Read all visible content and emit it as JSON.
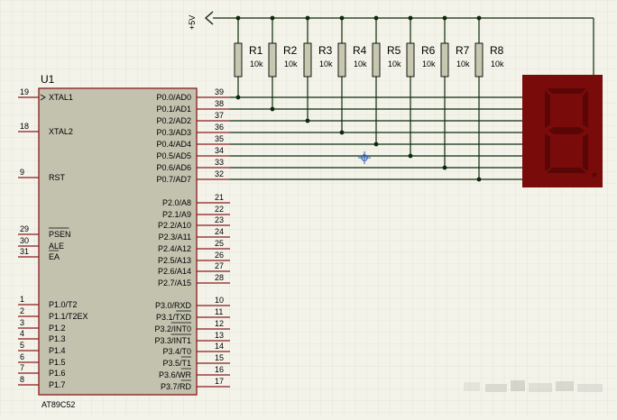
{
  "schematic": {
    "power_label": "+5V",
    "chip": {
      "ref": "U1",
      "part": "AT89C52",
      "left_pins": [
        {
          "num": "19",
          "label": "XTAL1"
        },
        {
          "num": "18",
          "label": "XTAL2"
        },
        {
          "num": "9",
          "label": "RST"
        },
        {
          "num": "29",
          "label": "PSEN"
        },
        {
          "num": "30",
          "label": "ALE"
        },
        {
          "num": "31",
          "label": "EA"
        },
        {
          "num": "1",
          "label": "P1.0/T2"
        },
        {
          "num": "2",
          "label": "P1.1/T2EX"
        },
        {
          "num": "3",
          "label": "P1.2"
        },
        {
          "num": "4",
          "label": "P1.3"
        },
        {
          "num": "5",
          "label": "P1.4"
        },
        {
          "num": "6",
          "label": "P1.5"
        },
        {
          "num": "7",
          "label": "P1.6"
        },
        {
          "num": "8",
          "label": "P1.7"
        }
      ],
      "right_pins": [
        {
          "num": "39",
          "label": "P0.0/AD0"
        },
        {
          "num": "38",
          "label": "P0.1/AD1"
        },
        {
          "num": "37",
          "label": "P0.2/AD2"
        },
        {
          "num": "36",
          "label": "P0.3/AD3"
        },
        {
          "num": "35",
          "label": "P0.4/AD4"
        },
        {
          "num": "34",
          "label": "P0.5/AD5"
        },
        {
          "num": "33",
          "label": "P0.6/AD6"
        },
        {
          "num": "32",
          "label": "P0.7/AD7"
        },
        {
          "num": "21",
          "label": "P2.0/A8"
        },
        {
          "num": "22",
          "label": "P2.1/A9"
        },
        {
          "num": "23",
          "label": "P2.2/A10"
        },
        {
          "num": "24",
          "label": "P2.3/A11"
        },
        {
          "num": "25",
          "label": "P2.4/A12"
        },
        {
          "num": "26",
          "label": "P2.5/A13"
        },
        {
          "num": "27",
          "label": "P2.6/A14"
        },
        {
          "num": "28",
          "label": "P2.7/A15"
        },
        {
          "num": "10",
          "label": "P3.0/RXD"
        },
        {
          "num": "11",
          "label": "P3.1/TXD"
        },
        {
          "num": "12",
          "label": "P3.2/INT0"
        },
        {
          "num": "13",
          "label": "P3.3/INT1"
        },
        {
          "num": "14",
          "label": "P3.4/T0"
        },
        {
          "num": "15",
          "label": "P3.5/T1"
        },
        {
          "num": "16",
          "label": "P3.6/WR"
        },
        {
          "num": "17",
          "label": "P3.7/RD"
        }
      ]
    },
    "resistors": [
      {
        "name": "R1",
        "value": "10k"
      },
      {
        "name": "R2",
        "value": "10k"
      },
      {
        "name": "R3",
        "value": "10k"
      },
      {
        "name": "R4",
        "value": "10k"
      },
      {
        "name": "R5",
        "value": "10k"
      },
      {
        "name": "R6",
        "value": "10k"
      },
      {
        "name": "R7",
        "value": "10k"
      },
      {
        "name": "R8",
        "value": "10k"
      }
    ],
    "display_digit": "8",
    "colors": {
      "background": "#f3f3ea",
      "grid": "#d9d9cc",
      "chip_body": "#c2c2af",
      "chip_border": "#8b1a1a",
      "resistor_fill": "#c8c7b0",
      "wire": "#0b2a0b",
      "display_body": "#7a0b0b",
      "segment_on": "#5a0606"
    }
  }
}
